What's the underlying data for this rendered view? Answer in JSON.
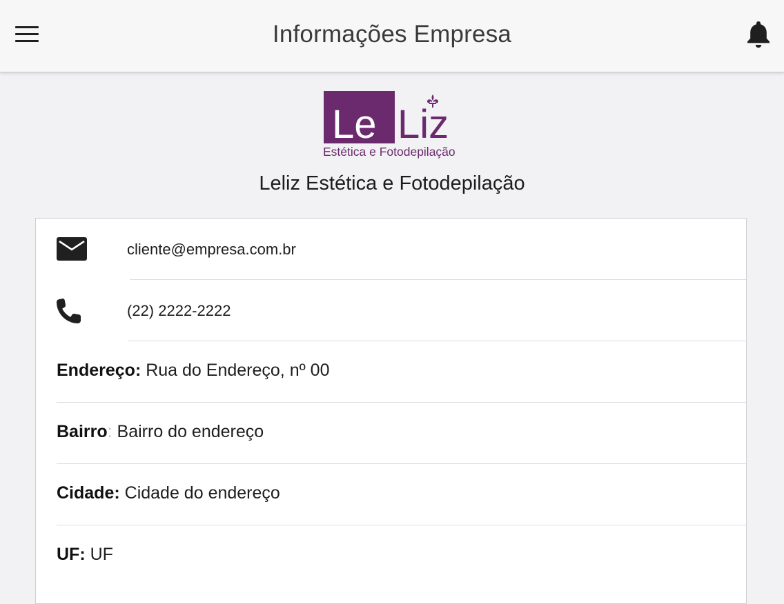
{
  "header": {
    "title": "Informações Empresa",
    "menu_icon": "hamburger-menu-icon",
    "notification_icon": "bell-icon"
  },
  "logo": {
    "part1": "Le",
    "part2": "Liz",
    "tagline": "Estética e Fotodepilação",
    "brand_color": "#6b2a6e"
  },
  "company": {
    "name": "Leliz Estética e Fotodepilação"
  },
  "contact": {
    "email": "cliente@empresa.com.br",
    "email_icon": "envelope-icon",
    "phone": "(22) 2222-2222",
    "phone_icon": "phone-icon"
  },
  "address": {
    "street_label": "Endereço",
    "street_value": "Rua do Endereço, nº 00",
    "district_label": "Bairro",
    "district_value": "Bairro do endereço",
    "city_label": "Cidade",
    "city_value": "Cidade do endereço",
    "state_label": "UF",
    "state_value": "UF"
  }
}
